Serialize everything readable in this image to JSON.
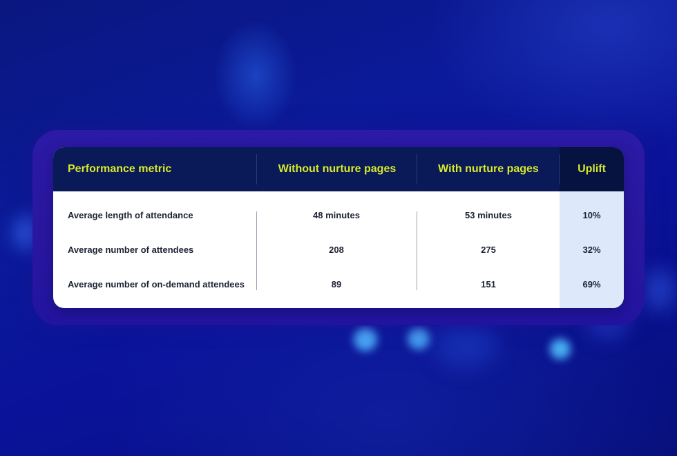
{
  "table": {
    "headers": {
      "metric": "Performance metric",
      "without": "Without nurture pages",
      "with": "With nurture pages",
      "uplift": "Uplift"
    },
    "rows": [
      {
        "metric": "Average length of attendance",
        "without": "48 minutes",
        "with": "53 minutes",
        "uplift": "10%"
      },
      {
        "metric": "Average number of attendees",
        "without": "208",
        "with": "275",
        "uplift": "32%"
      },
      {
        "metric": "Average number of on-demand attendees",
        "without": "89",
        "with": "151",
        "uplift": "69%"
      }
    ]
  },
  "colors": {
    "header_background": "#0a1957",
    "header_text": "#d7ea2a",
    "uplift_column_background": "#dde8fb",
    "frame": "#2a17a0",
    "page_background": "#0b1a9a"
  }
}
